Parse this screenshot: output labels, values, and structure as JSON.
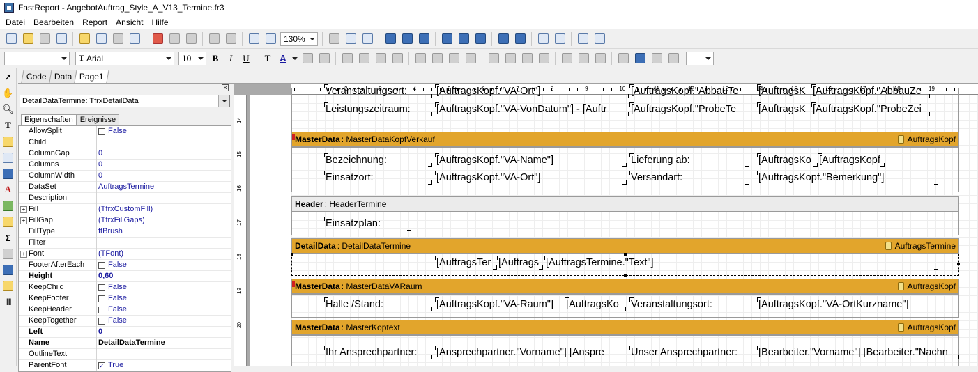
{
  "window": {
    "title": "FastReport - AngebotAuftrag_Style_A_V13_Termine.fr3"
  },
  "menu": [
    "Datei",
    "Bearbeiten",
    "Report",
    "Ansicht",
    "Hilfe"
  ],
  "toolbar": {
    "zoom": "130%",
    "font_name": "Arial",
    "font_size": "10",
    "style_combo": "",
    "frame_combo": ""
  },
  "tabs": [
    "Code",
    "Data",
    "Page1"
  ],
  "inspector": {
    "object_select": "DetailDataTermine: TfrxDetailData",
    "tabs": [
      "Eigenschaften",
      "Ereignisse"
    ],
    "properties": [
      {
        "name": "AllowSplit",
        "value": "False",
        "checkbox": true
      },
      {
        "name": "Child",
        "value": ""
      },
      {
        "name": "ColumnGap",
        "value": "0"
      },
      {
        "name": "Columns",
        "value": "0"
      },
      {
        "name": "ColumnWidth",
        "value": "0"
      },
      {
        "name": "DataSet",
        "value": "AuftragsTermine"
      },
      {
        "name": "Description",
        "value": ""
      },
      {
        "name": "Fill",
        "value": "(TfrxCustomFill)",
        "expandable": true
      },
      {
        "name": "FillGap",
        "value": "(TfrxFillGaps)",
        "expandable": true
      },
      {
        "name": "FillType",
        "value": "ftBrush"
      },
      {
        "name": "Filter",
        "value": ""
      },
      {
        "name": "Font",
        "value": "(TFont)",
        "expandable": true
      },
      {
        "name": "FooterAfterEach",
        "value": "False",
        "checkbox": true
      },
      {
        "name": "Height",
        "value": "0,60",
        "bold": true
      },
      {
        "name": "KeepChild",
        "value": "False",
        "checkbox": true
      },
      {
        "name": "KeepFooter",
        "value": "False",
        "checkbox": true
      },
      {
        "name": "KeepHeader",
        "value": "False",
        "checkbox": true
      },
      {
        "name": "KeepTogether",
        "value": "False",
        "checkbox": true
      },
      {
        "name": "Left",
        "value": "0",
        "bold": true
      },
      {
        "name": "Name",
        "value": "DetailDataTermine",
        "bold": true,
        "black": true
      },
      {
        "name": "OutlineText",
        "value": ""
      },
      {
        "name": "ParentFont",
        "value": "True",
        "checkbox": true,
        "checked": true
      }
    ]
  },
  "ruler": {
    "h_numbers": [
      "2",
      "3",
      "4",
      "5",
      "6",
      "7",
      "8",
      "9",
      "10",
      "11",
      "12",
      "13",
      "14",
      "15",
      "16",
      "17",
      "18",
      "19"
    ],
    "v_numbers": [
      "14",
      "15",
      "16",
      "17",
      "18",
      "19",
      "20"
    ]
  },
  "report": {
    "top_fields": {
      "row1": [
        "Veranstaltungsort:",
        "[AuftragsKopf.\"VA-Ort\"]",
        "[AuftragsKopf.\"AbbauTe",
        "[AuftragsK",
        "[AuftragsKopf.\"AbbauZe"
      ],
      "row2": [
        "Leistungszeitraum:",
        "[AuftragsKopf.\"VA-VonDatum\"] - [Auftr",
        "[AuftragsKopf.\"ProbeTe",
        "[AuftragsK",
        "[AuftragsKopf.\"ProbeZei"
      ]
    },
    "bands": [
      {
        "kind": "MasterData",
        "name": "MasterDataKopfVerkauf",
        "dataset": "AuftragsKopf",
        "fields": [
          [
            "Bezeichnung:",
            "[AuftragsKopf.\"VA-Name\"]",
            "Lieferung ab:",
            "[AuftragsKo",
            "[AuftragsKopf"
          ],
          [
            "Einsatzort:",
            "[AuftragsKopf.\"VA-Ort\"]",
            "Versandart:",
            "[AuftragsKopf.\"Bemerkung\"]"
          ]
        ]
      },
      {
        "kind": "Header",
        "name": "HeaderTermine",
        "dataset": "",
        "fields": [
          [
            "Einsatzplan:"
          ]
        ]
      },
      {
        "kind": "DetailData",
        "name": "DetailDataTermine",
        "dataset": "AuftragsTermine",
        "fields": [
          [
            "[AuftragsTer",
            "[Auftrags",
            "[AuftragsTermine.\"Text\"]"
          ]
        ]
      },
      {
        "kind": "MasterData",
        "name": "MasterDataVARaum",
        "dataset": "AuftragsKopf",
        "fields": [
          [
            "Halle /Stand:",
            "[AuftragsKopf.\"VA-Raum\"]",
            "[AuftragsKo",
            "Veranstaltungsort:",
            "[AuftragsKopf.\"VA-OrtKurzname\"]"
          ]
        ]
      },
      {
        "kind": "MasterData",
        "name": "MasterKoptext",
        "dataset": "AuftragsKopf",
        "fields": [
          [
            "Ihr Ansprechpartner:",
            "[Ansprechpartner.\"Vorname\"] [Anspre",
            "Unser Ansprechpartner:",
            "[Bearbeiter.\"Vorname\"] [Bearbeiter.\"Nachn"
          ]
        ]
      }
    ]
  },
  "colors": {
    "band_orange": "#e2a52c",
    "band_grey": "#ebebeb",
    "prop_value_blue": "#1a1aa0"
  }
}
